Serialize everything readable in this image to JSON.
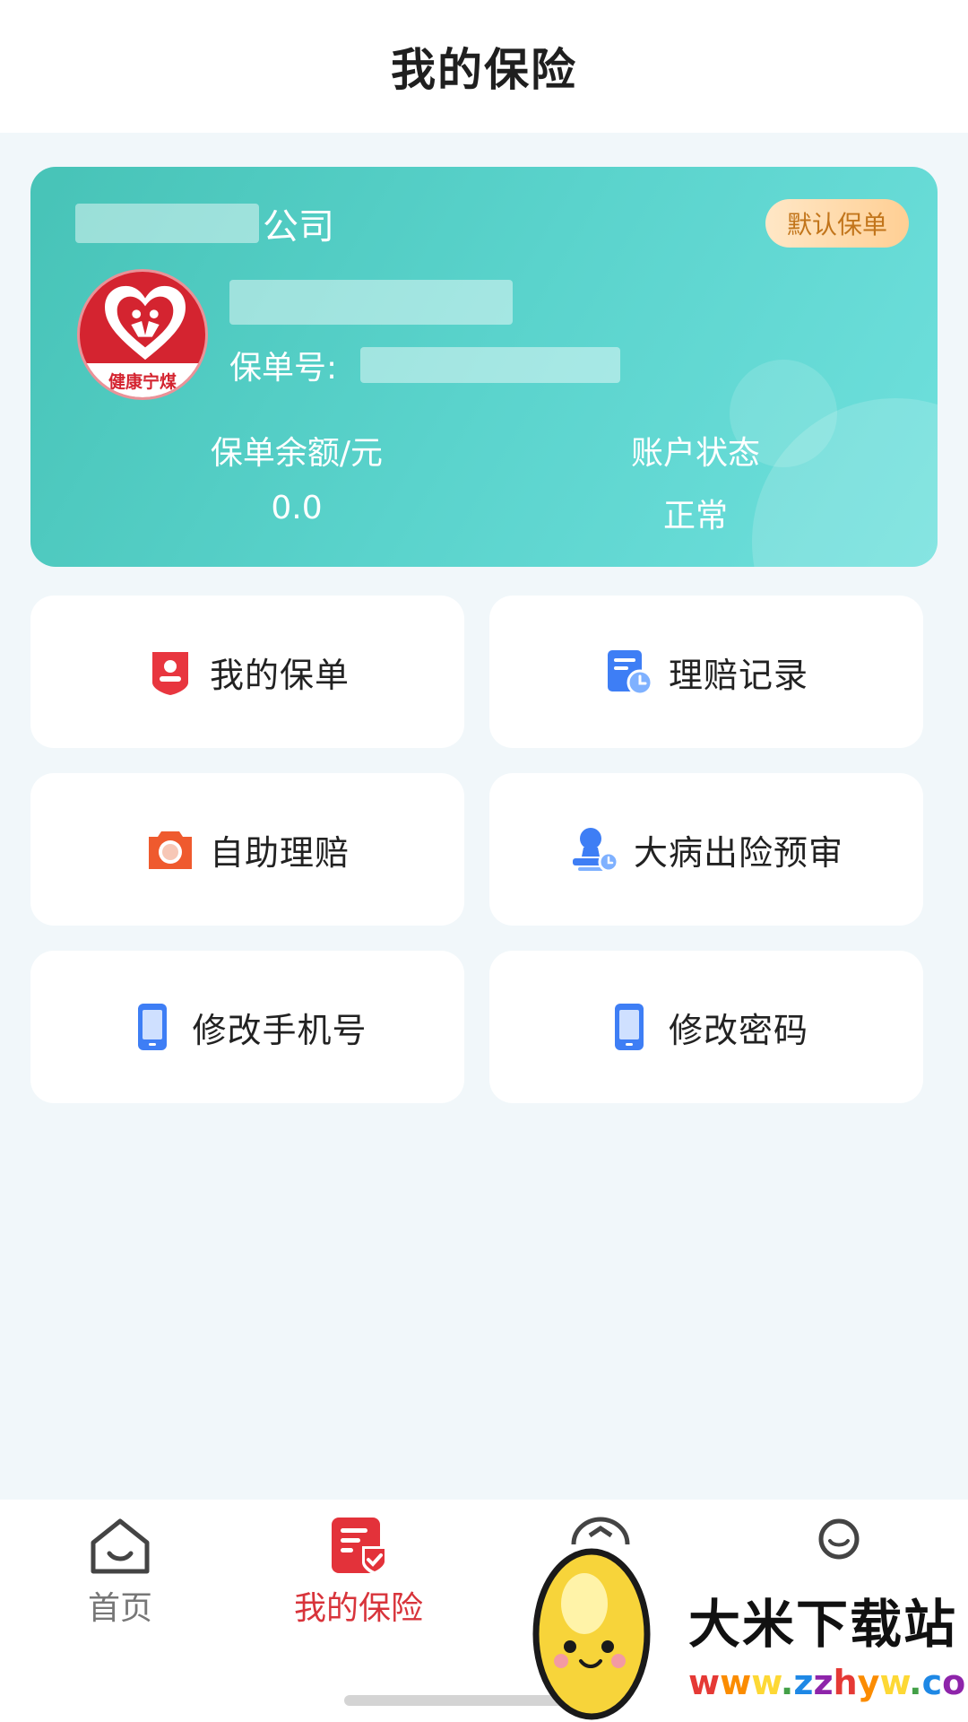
{
  "header": {
    "title": "我的保险"
  },
  "policy_card": {
    "company_suffix": "公司",
    "default_badge": "默认保单",
    "logo_text": "健康宁煤",
    "policy_no_label": "保单号:",
    "balance_label": "保单余额/元",
    "balance_value": "0.0",
    "status_label": "账户状态",
    "status_value": "正常",
    "accent": "#4fc9bf"
  },
  "menu": {
    "my_policy": "我的保单",
    "claim_records": "理赔记录",
    "self_claim": "自助理赔",
    "critical_illness_review": "大病出险预审",
    "change_phone": "修改手机号",
    "change_password": "修改密码"
  },
  "bottom_nav": {
    "home": "首页",
    "my_insurance": "我的保险",
    "active_color": "#d8343b"
  },
  "watermark": {
    "title": "大米下载站",
    "url": "www.zzhyw.com"
  }
}
